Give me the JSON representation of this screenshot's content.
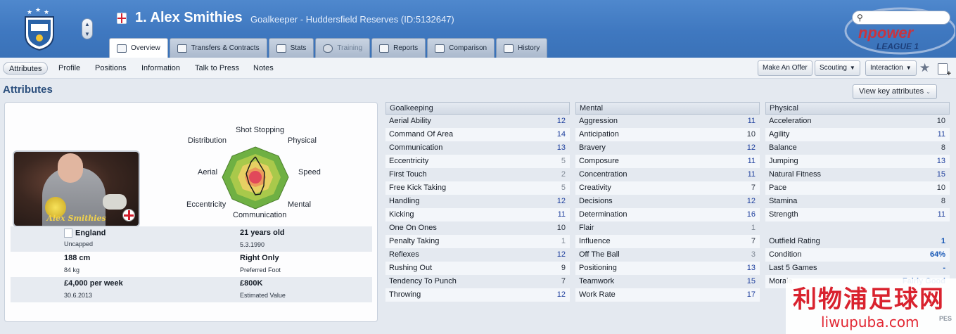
{
  "header": {
    "player_name": "1. Alex Smithies",
    "player_sub": "Goalkeeper - Huddersfield Reserves (ID:5132647)",
    "league_logo_text_1": "npower",
    "league_logo_text_2": "LEAGUE 1"
  },
  "tabs": [
    {
      "label": "Overview",
      "state": "active"
    },
    {
      "label": "Transfers & Contracts",
      "state": "normal"
    },
    {
      "label": "Stats",
      "state": "normal"
    },
    {
      "label": "Training",
      "state": "disabled"
    },
    {
      "label": "Reports",
      "state": "normal"
    },
    {
      "label": "Comparison",
      "state": "normal"
    },
    {
      "label": "History",
      "state": "normal"
    }
  ],
  "subnav": {
    "items": [
      "Attributes",
      "Profile",
      "Positions",
      "Information",
      "Talk to Press",
      "Notes"
    ],
    "make_offer": "Make An Offer",
    "scouting": "Scouting",
    "interaction": "Interaction"
  },
  "section_title": "Attributes",
  "key_attributes_button": "View key attributes",
  "photo_name": "Alex Smithies",
  "radar_labels": [
    "Shot Stopping",
    "Physical",
    "Speed",
    "Mental",
    "Communication",
    "Eccentricity",
    "Aerial",
    "Distribution"
  ],
  "info": {
    "nation": "England",
    "caps": "Uncapped",
    "age": "21 years old",
    "dob": "5.3.1990",
    "height": "188 cm",
    "weight": "84 kg",
    "foot": "Right Only",
    "foot_label": "Preferred Foot",
    "wage": "£4,000 per week",
    "contract_end": "30.6.2013",
    "value": "£800K",
    "value_label": "Estimated Value"
  },
  "goalkeeping": {
    "title": "Goalkeeping",
    "rows": [
      {
        "name": "Aerial Ability",
        "value": "12"
      },
      {
        "name": "Command Of Area",
        "value": "14"
      },
      {
        "name": "Communication",
        "value": "13"
      },
      {
        "name": "Eccentricity",
        "value": "5"
      },
      {
        "name": "First Touch",
        "value": "2"
      },
      {
        "name": "Free Kick Taking",
        "value": "5"
      },
      {
        "name": "Handling",
        "value": "12"
      },
      {
        "name": "Kicking",
        "value": "11"
      },
      {
        "name": "One On Ones",
        "value": "10"
      },
      {
        "name": "Penalty Taking",
        "value": "1"
      },
      {
        "name": "Reflexes",
        "value": "12"
      },
      {
        "name": "Rushing Out",
        "value": "9"
      },
      {
        "name": "Tendency To Punch",
        "value": "7"
      },
      {
        "name": "Throwing",
        "value": "12"
      }
    ]
  },
  "mental": {
    "title": "Mental",
    "rows": [
      {
        "name": "Aggression",
        "value": "11"
      },
      {
        "name": "Anticipation",
        "value": "10"
      },
      {
        "name": "Bravery",
        "value": "12"
      },
      {
        "name": "Composure",
        "value": "11"
      },
      {
        "name": "Concentration",
        "value": "11"
      },
      {
        "name": "Creativity",
        "value": "7"
      },
      {
        "name": "Decisions",
        "value": "12"
      },
      {
        "name": "Determination",
        "value": "16"
      },
      {
        "name": "Flair",
        "value": "1"
      },
      {
        "name": "Influence",
        "value": "7"
      },
      {
        "name": "Off The Ball",
        "value": "3"
      },
      {
        "name": "Positioning",
        "value": "13"
      },
      {
        "name": "Teamwork",
        "value": "15"
      },
      {
        "name": "Work Rate",
        "value": "17"
      }
    ]
  },
  "physical": {
    "title": "Physical",
    "rows": [
      {
        "name": "Acceleration",
        "value": "10"
      },
      {
        "name": "Agility",
        "value": "11"
      },
      {
        "name": "Balance",
        "value": "8"
      },
      {
        "name": "Jumping",
        "value": "13"
      },
      {
        "name": "Natural Fitness",
        "value": "15"
      },
      {
        "name": "Pace",
        "value": "10"
      },
      {
        "name": "Stamina",
        "value": "8"
      },
      {
        "name": "Strength",
        "value": "11"
      }
    ],
    "extra": [
      {
        "name": "Outfield Rating",
        "value": "1"
      },
      {
        "name": "Condition",
        "value": "64%"
      },
      {
        "name": "Last 5 Games",
        "value": "-"
      },
      {
        "name": "Morale",
        "value": "Fairly Good"
      }
    ]
  },
  "watermark": {
    "chars": "利物浦足球网",
    "url": "liwupuba.com",
    "tag": "PES"
  }
}
